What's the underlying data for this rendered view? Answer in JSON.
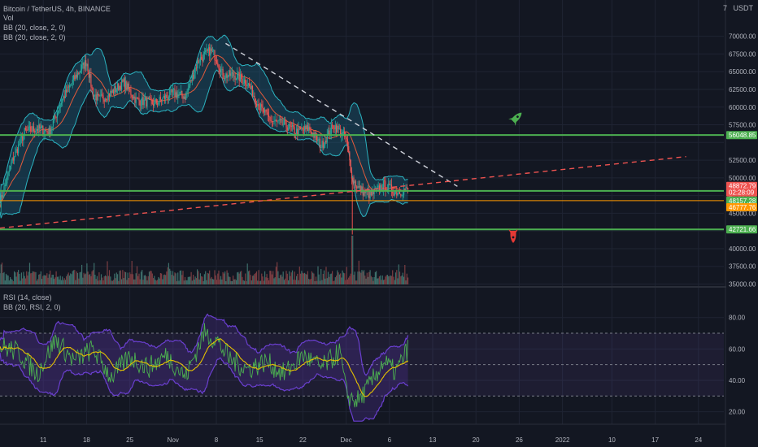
{
  "header": {
    "symbol_line": "Bitcoin / TetherUS, 4h, BINANCE",
    "vol_label": "Vol",
    "bb1_label": "BB (20, close, 2, 0)",
    "bb2_label": "BB (20, close, 2, 0)",
    "currency_label": "USDT",
    "settings_glyph": "7"
  },
  "rsi_header": {
    "rsi_label": "RSI (14, close)",
    "bb_rsi_label": "BB (20, RSI, 2, 0)"
  },
  "colors": {
    "background": "#131722",
    "up_candle": "#26a69a",
    "down_candle": "#ef5350",
    "bollinger_fill": "#1e6a8a",
    "bollinger_line": "#2bb3c0",
    "support_line": "#4caf50",
    "trend_line_dashed_red": "#ef5350",
    "trend_line_dashed_white": "#d1d4dc",
    "rsi_line": "#4caf50",
    "rsi_ma": "#e6c200",
    "rsi_band": "#6a3fcf",
    "orange_line": "#ff9800"
  },
  "icons": {
    "rocket_up": "rocket-icon",
    "rocket_down": "rocket-down-icon"
  },
  "chart_data": [
    {
      "type": "candlestick",
      "title": "Bitcoin / TetherUS, 4h, BINANCE",
      "ylabel": "USDT",
      "ylim": [
        34000,
        72500
      ],
      "y_ticks": [
        35000,
        37500,
        40000,
        42500,
        45000,
        47500,
        50000,
        52500,
        55000,
        57500,
        60000,
        62500,
        65000,
        67500,
        70000
      ],
      "y_tick_labels": [
        "35000.00",
        "37500.00",
        "40000.00",
        "42500.00",
        "45000.00",
        "47500.00",
        "50000.00",
        "52500.00",
        "55000.00",
        "57500.00",
        "60000.00",
        "62500.00",
        "65000.00",
        "67500.00",
        "70000.00"
      ],
      "x_tick_labels": [
        "11",
        "18",
        "25",
        "Nov",
        "8",
        "15",
        "22",
        "Dec",
        "6",
        "13",
        "20",
        "26",
        "2022",
        "10",
        "17",
        "24"
      ],
      "close_path": {
        "x_days": [
          0,
          2,
          4,
          6,
          8,
          10,
          12,
          14,
          15,
          16,
          18,
          20,
          22,
          25,
          28,
          30,
          32,
          34,
          35,
          36,
          38,
          40,
          42,
          44,
          46,
          48,
          50,
          52,
          54,
          56,
          57,
          58,
          60,
          62,
          64,
          66
        ],
        "close": [
          46500,
          52500,
          56500,
          57000,
          56500,
          61000,
          64000,
          66500,
          62000,
          61000,
          62000,
          63500,
          61000,
          60500,
          62000,
          61500,
          66500,
          68000,
          67000,
          64500,
          64500,
          63500,
          60000,
          58000,
          57500,
          56500,
          57000,
          54500,
          57500,
          55500,
          50000,
          48500,
          47500,
          49000,
          48000,
          48300
        ]
      },
      "volume_spike_day": 57,
      "price_tags": [
        {
          "label": "56048.85",
          "value": 56048.85,
          "color": "#4caf50"
        },
        {
          "label": "48872.79",
          "value": 48872.79,
          "color": "#ef5350"
        },
        {
          "label": "02:28:09",
          "value": 47950,
          "color": "#ef5350"
        },
        {
          "label": "48157.28",
          "value": 46780,
          "color": "#4caf50"
        },
        {
          "label": "46777.76",
          "value": 45850,
          "color": "#ff9800"
        },
        {
          "label": "42721.66",
          "value": 42721.66,
          "color": "#4caf50"
        }
      ],
      "horizontal_lines": [
        {
          "value": 56048.85,
          "color": "#4caf50"
        },
        {
          "value": 48157.28,
          "color": "#4caf50"
        },
        {
          "value": 46777.76,
          "color": "#ff9800"
        },
        {
          "value": 42721.66,
          "color": "#4caf50"
        }
      ],
      "trend_lines": [
        {
          "style": "dashed",
          "color": "#d1d4dc",
          "from": [
            36.5,
            69000
          ],
          "to": [
            74,
            48800
          ]
        },
        {
          "style": "dashed",
          "color": "#ef5350",
          "from": [
            0,
            42900
          ],
          "to": [
            111,
            53000
          ]
        }
      ]
    },
    {
      "type": "line",
      "title": "RSI (14, close)",
      "ylim": [
        13,
        95
      ],
      "y_ticks": [
        20,
        40,
        60,
        80
      ],
      "y_tick_labels": [
        "20.00",
        "40.00",
        "60.00",
        "80.00"
      ],
      "bands": [
        30,
        50,
        70
      ],
      "series": [
        {
          "name": "RSI (14, close)",
          "x_days": [
            0,
            3,
            6,
            9,
            12,
            15,
            18,
            21,
            24,
            27,
            30,
            33,
            35,
            37,
            40,
            43,
            46,
            49,
            52,
            55,
            56,
            57,
            58,
            60,
            62,
            64,
            66
          ],
          "values": [
            62,
            58,
            44,
            66,
            52,
            60,
            42,
            55,
            48,
            56,
            42,
            70,
            66,
            54,
            47,
            52,
            44,
            56,
            48,
            58,
            32,
            28,
            27,
            38,
            52,
            45,
            60
          ]
        }
      ]
    }
  ]
}
